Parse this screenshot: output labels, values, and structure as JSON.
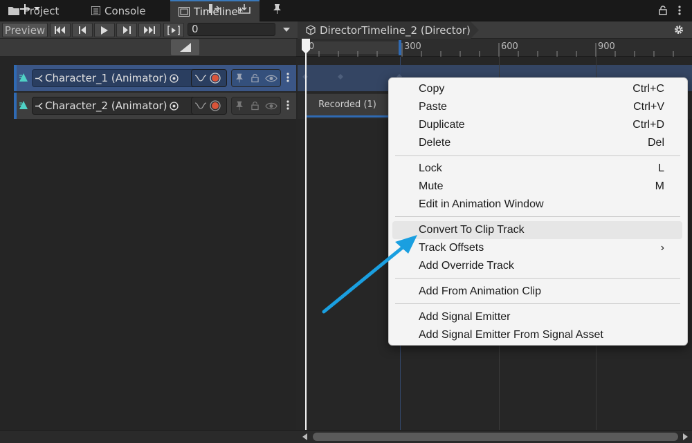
{
  "tabs": [
    {
      "label": "Project"
    },
    {
      "label": "Console"
    },
    {
      "label": "Timeline*"
    }
  ],
  "toolbar": {
    "preview_label": "Preview",
    "frame_value": "0",
    "breadcrumb": "DirectorTimeline_2 (Director)"
  },
  "ruler": {
    "ticks": [
      "0",
      "300",
      "600",
      "900"
    ]
  },
  "tracks": [
    {
      "name": "Character_1 (Animator)",
      "selected": true
    },
    {
      "name": "Character_2 (Animator)",
      "selected": false
    }
  ],
  "clip": {
    "label": "Recorded (1)"
  },
  "context_menu": {
    "items": [
      {
        "label": "Copy",
        "shortcut": "Ctrl+C"
      },
      {
        "label": "Paste",
        "shortcut": "Ctrl+V"
      },
      {
        "label": "Duplicate",
        "shortcut": "Ctrl+D"
      },
      {
        "label": "Delete",
        "shortcut": "Del"
      },
      {
        "label": "Lock",
        "shortcut": "L"
      },
      {
        "label": "Mute",
        "shortcut": "M"
      },
      {
        "label": "Edit in Animation Window",
        "shortcut": ""
      },
      {
        "label": "Convert To Clip Track",
        "shortcut": ""
      },
      {
        "label": "Track Offsets",
        "shortcut": "›"
      },
      {
        "label": "Add Override Track",
        "shortcut": ""
      },
      {
        "label": "Add From Animation Clip",
        "shortcut": ""
      },
      {
        "label": "Add Signal Emitter",
        "shortcut": ""
      },
      {
        "label": "Add Signal Emitter From Signal Asset",
        "shortcut": ""
      }
    ]
  },
  "colors": {
    "accent": "#2f6ab3",
    "annotation_arrow": "#1a9fe0",
    "record": "#d9553a"
  }
}
